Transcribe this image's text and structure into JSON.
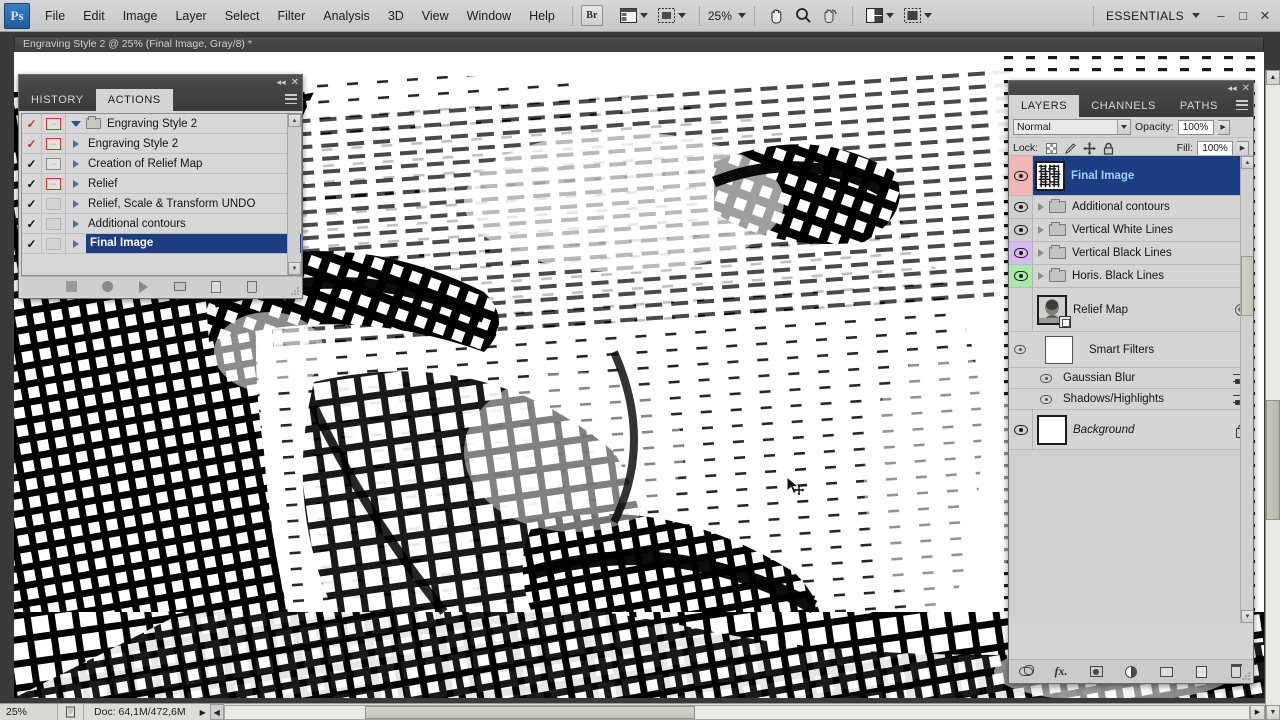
{
  "app": {
    "name": "Adobe Photoshop",
    "logo_text": "Ps"
  },
  "menubar": {
    "items": [
      "File",
      "Edit",
      "Image",
      "Layer",
      "Select",
      "Filter",
      "Analysis",
      "3D",
      "View",
      "Window",
      "Help"
    ],
    "bridge_label": "Br",
    "screen_mode_label": "",
    "zoom_value": "25%",
    "tools": [
      "hand-tool",
      "zoom-tool",
      "rotate-view-tool"
    ],
    "workspace_label": "ESSENTIALS",
    "window_buttons": [
      "minimize",
      "maximize",
      "close"
    ]
  },
  "document": {
    "tab_title": "Engraving Style 2 @ 25% (Final Image, Gray/8) *",
    "zoom": "25%",
    "doc_info": "Doc: 64,1M/472,6M"
  },
  "actions_panel": {
    "title_tabs": [
      "HISTORY",
      "ACTIONS"
    ],
    "active_tab": "ACTIONS",
    "rows": [
      {
        "label": "Engraving Style 2",
        "checked": true,
        "check_color": "red",
        "dialog": "red",
        "type": "set",
        "expanded": true,
        "selected": false
      },
      {
        "label": "Engraving Style 2",
        "checked": true,
        "check_color": "red",
        "dialog": "red",
        "type": "action",
        "expanded": false,
        "selected": false
      },
      {
        "label": "Creation of Relief Map",
        "checked": true,
        "check_color": "black",
        "dialog": "gray",
        "type": "action",
        "expanded": false,
        "selected": false
      },
      {
        "label": "Relief",
        "checked": true,
        "check_color": "black",
        "dialog": "red",
        "type": "action",
        "expanded": false,
        "selected": false
      },
      {
        "label": "Relief, Scale & Transform UNDO",
        "checked": true,
        "check_color": "black",
        "dialog": "blank",
        "type": "action",
        "expanded": false,
        "selected": false
      },
      {
        "label": "Additional contours",
        "checked": true,
        "check_color": "black",
        "dialog": "blank",
        "type": "action",
        "expanded": false,
        "selected": false
      },
      {
        "label": "Final Image",
        "checked": true,
        "check_color": "black",
        "dialog": "blank",
        "type": "action",
        "expanded": false,
        "selected": true
      }
    ],
    "footer_buttons": [
      "stop-button",
      "record-button",
      "play-button",
      "new-set-button",
      "new-action-button",
      "delete-button"
    ]
  },
  "layers_panel": {
    "title_tabs": [
      "LAYERS",
      "CHANNELS",
      "PATHS"
    ],
    "active_tab": "LAYERS",
    "blend_mode": "Normal",
    "opacity_label": "Opacity:",
    "opacity_value": "100%",
    "lock_label": "Lock:",
    "fill_label": "Fill:",
    "fill_value": "100%",
    "lock_buttons": [
      "lock-transparent-pixels",
      "lock-image-pixels",
      "lock-position",
      "lock-all"
    ],
    "layers": [
      {
        "name": "Final Image",
        "visible": true,
        "selected": true,
        "kind": "image",
        "color": "#f3b6b6",
        "thumb": "engraving"
      },
      {
        "name": "Additional contours",
        "visible": true,
        "selected": false,
        "kind": "group",
        "color": "#c9c9c9"
      },
      {
        "name": "Vertical White Lines",
        "visible": true,
        "selected": false,
        "kind": "group",
        "color": "#c9c9c9"
      },
      {
        "name": "Vertical Black Lines",
        "visible": true,
        "selected": false,
        "kind": "group",
        "color": "#d9b8f0"
      },
      {
        "name": "Horis. Black Lines",
        "visible": true,
        "selected": false,
        "kind": "group",
        "color": "#a8e8a8"
      },
      {
        "name": "Relief Map",
        "visible": false,
        "selected": false,
        "kind": "smart-object",
        "thumb": "portrait"
      },
      {
        "name": "Smart Filters",
        "visible": true,
        "selected": false,
        "kind": "smart-filter-header"
      },
      {
        "name": "Gaussian Blur",
        "visible": true,
        "selected": false,
        "kind": "smart-filter"
      },
      {
        "name": "Shadows/Highlights",
        "visible": true,
        "selected": false,
        "kind": "smart-filter"
      },
      {
        "name": "Background",
        "visible": true,
        "selected": false,
        "kind": "background",
        "locked": true,
        "italic": true
      }
    ],
    "footer_buttons": [
      "link-layers-icon",
      "layer-style-fx-icon",
      "add-layer-mask-icon",
      "new-adjustment-layer-icon",
      "new-group-icon",
      "new-layer-icon",
      "delete-layer-icon"
    ]
  },
  "colors": {
    "selection_blue": "#1c3c84",
    "selection_text": "#9fd0ff",
    "panel_bg": "#d4d4d4",
    "panel_dark": "#3b3b3b",
    "app_bg": "#3a3a3a",
    "menubar_bg": "#d0d0d0"
  }
}
